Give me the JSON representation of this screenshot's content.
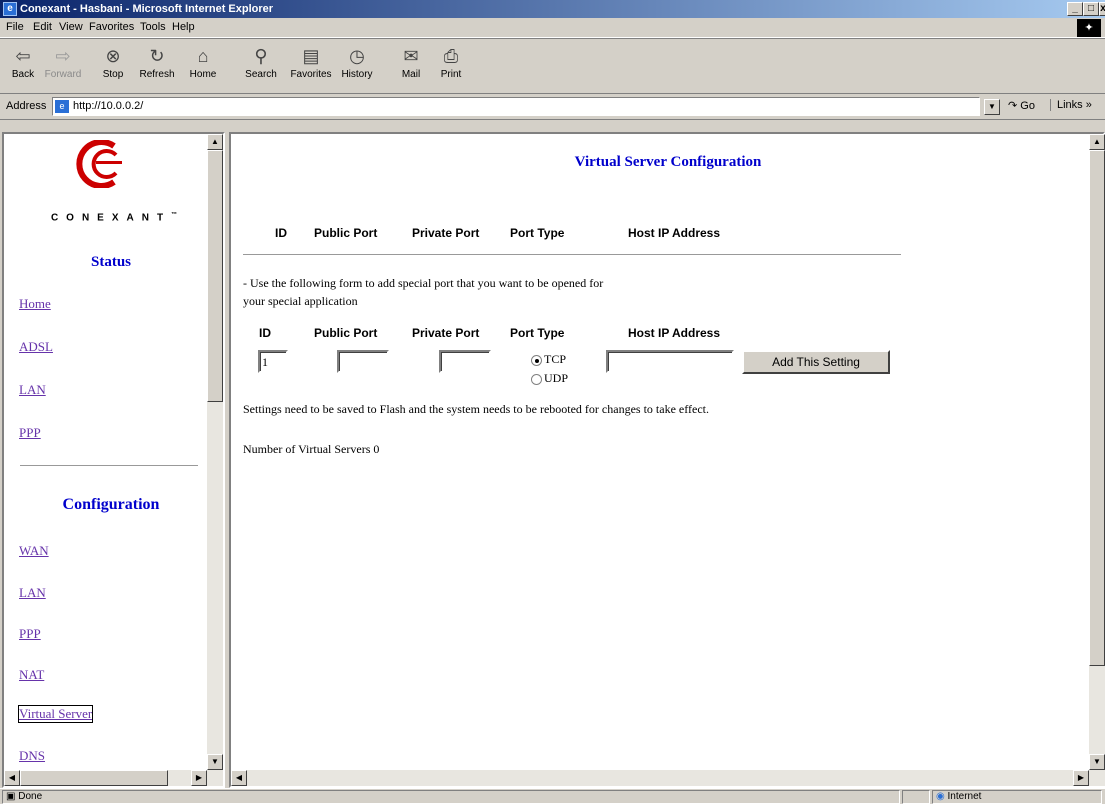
{
  "window": {
    "title": "Conexant - Hasbani - Microsoft Internet Explorer"
  },
  "menu": [
    "File",
    "Edit",
    "View",
    "Favorites",
    "Tools",
    "Help"
  ],
  "toolbar": {
    "back": "Back",
    "forward": "Forward",
    "stop": "Stop",
    "refresh": "Refresh",
    "home": "Home",
    "search": "Search",
    "favorites": "Favorites",
    "history": "History",
    "mail": "Mail",
    "print": "Print"
  },
  "address": {
    "label": "Address",
    "url": "http://10.0.0.2/",
    "go": "Go",
    "links": "Links »"
  },
  "sidebar": {
    "brand": "CONEXANT",
    "brand_mark": "™",
    "status_heading": "Status",
    "status_links": [
      "Home",
      "ADSL",
      "LAN",
      "PPP"
    ],
    "config_heading": "Configuration",
    "config_links": [
      "WAN",
      "LAN",
      "PPP",
      "NAT",
      "Virtual Server",
      "DNS"
    ]
  },
  "main": {
    "title": "Virtual Server Configuration",
    "columns": [
      "ID",
      "Public Port",
      "Private Port",
      "Port Type",
      "Host IP Address"
    ],
    "instruction_line1": "- Use the following form to add special port that you want to be opened for",
    "instruction_line2": "your special application",
    "form": {
      "id_value": "1",
      "public_port": "",
      "private_port": "",
      "port_type_options": [
        "TCP",
        "UDP"
      ],
      "port_type_selected": "TCP",
      "host_ip": "",
      "add_button": "Add This Setting"
    },
    "notice": "Settings need to be saved to Flash and the system needs to be rebooted for changes to take effect.",
    "count_label": "Number of Virtual Servers",
    "count_value": "0"
  },
  "status": {
    "text": "Done",
    "zone": "Internet"
  },
  "colors": {
    "title_gradient_start": "#0a246a",
    "link_visited": "#6633aa",
    "heading_blue": "#0000cc"
  }
}
